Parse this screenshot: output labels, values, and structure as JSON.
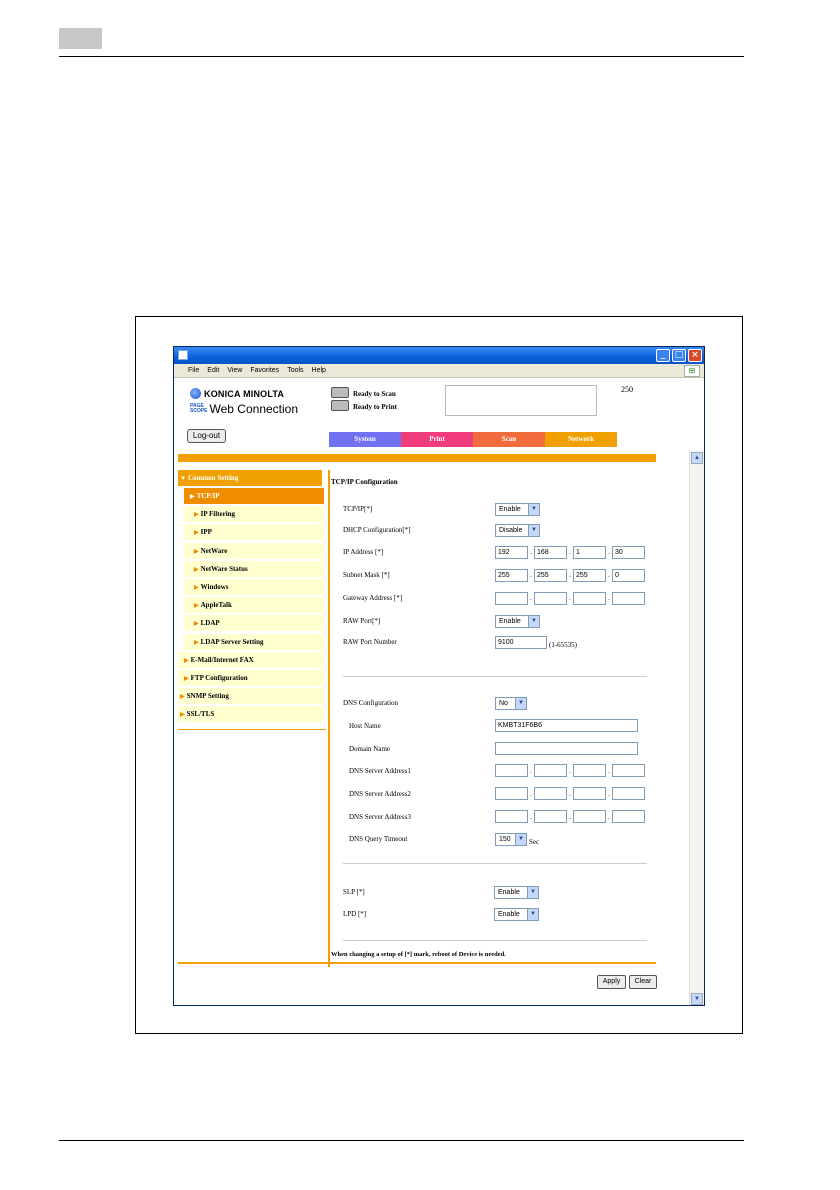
{
  "menu": [
    "File",
    "Edit",
    "View",
    "Favorites",
    "Tools",
    "Help"
  ],
  "brand": {
    "konica": "KONICA MINOLTA",
    "pagescope_top": "PAGE",
    "pagescope_bottom": "SCOPE",
    "web_connection": "Web Connection"
  },
  "status": {
    "scan": "Ready to Scan",
    "print": "Ready to Print",
    "counter": "250"
  },
  "logout": "Log-out",
  "tabs": [
    {
      "label": "System",
      "color": "#7070f0"
    },
    {
      "label": "Print",
      "color": "#f03c7c"
    },
    {
      "label": "Scan",
      "color": "#f06c3c"
    },
    {
      "label": "Network",
      "color": "#f0a000"
    }
  ],
  "sidebar": [
    "Common Setting",
    "TCP/IP",
    "IP Filtering",
    "IPP",
    "NetWare",
    "NetWare Status",
    "Windows",
    "AppleTalk",
    "LDAP",
    "LDAP Server Setting",
    "E-Mail/Internet FAX",
    "FTP Configuration",
    "SNMP Setting",
    "SSL/TLS"
  ],
  "form": {
    "title": "TCP/IP Configuration",
    "tcpip_label": "TCP/IP[*]",
    "tcpip_value": "Enable",
    "dhcp_label": "DHCP Configuration[*]",
    "dhcp_value": "Disable",
    "ip_label": "IP Address [*]",
    "ip": [
      "192",
      "168",
      "1",
      "30"
    ],
    "mask_label": "Subnet Mask [*]",
    "mask": [
      "255",
      "255",
      "255",
      "0"
    ],
    "gw_label": "Gateway Address [*]",
    "raw_port_label": "RAW Port[*]",
    "raw_port_value": "Enable",
    "raw_num_label": "RAW Port Number",
    "raw_num_value": "9100",
    "raw_num_range": "(1-65535)",
    "dns_label": "DNS Configuration",
    "dns_value": "No",
    "host_label": "Host Name",
    "host_value": "KMBT31F6B6",
    "domain_label": "Domain Name",
    "dns1_label": "DNS Server Address1",
    "dns2_label": "DNS Server Address2",
    "dns3_label": "DNS Server Address3",
    "timeout_label": "DNS Query Timeout",
    "timeout_value": "150",
    "timeout_unit": "Sec",
    "slp_label": "SLP [*]",
    "slp_value": "Enable",
    "lpd_label": "LPD [*]",
    "lpd_value": "Enable",
    "note": "When changing a setup of [*] mark, reboot of Device is needed.",
    "apply": "Apply",
    "clear": "Clear"
  }
}
